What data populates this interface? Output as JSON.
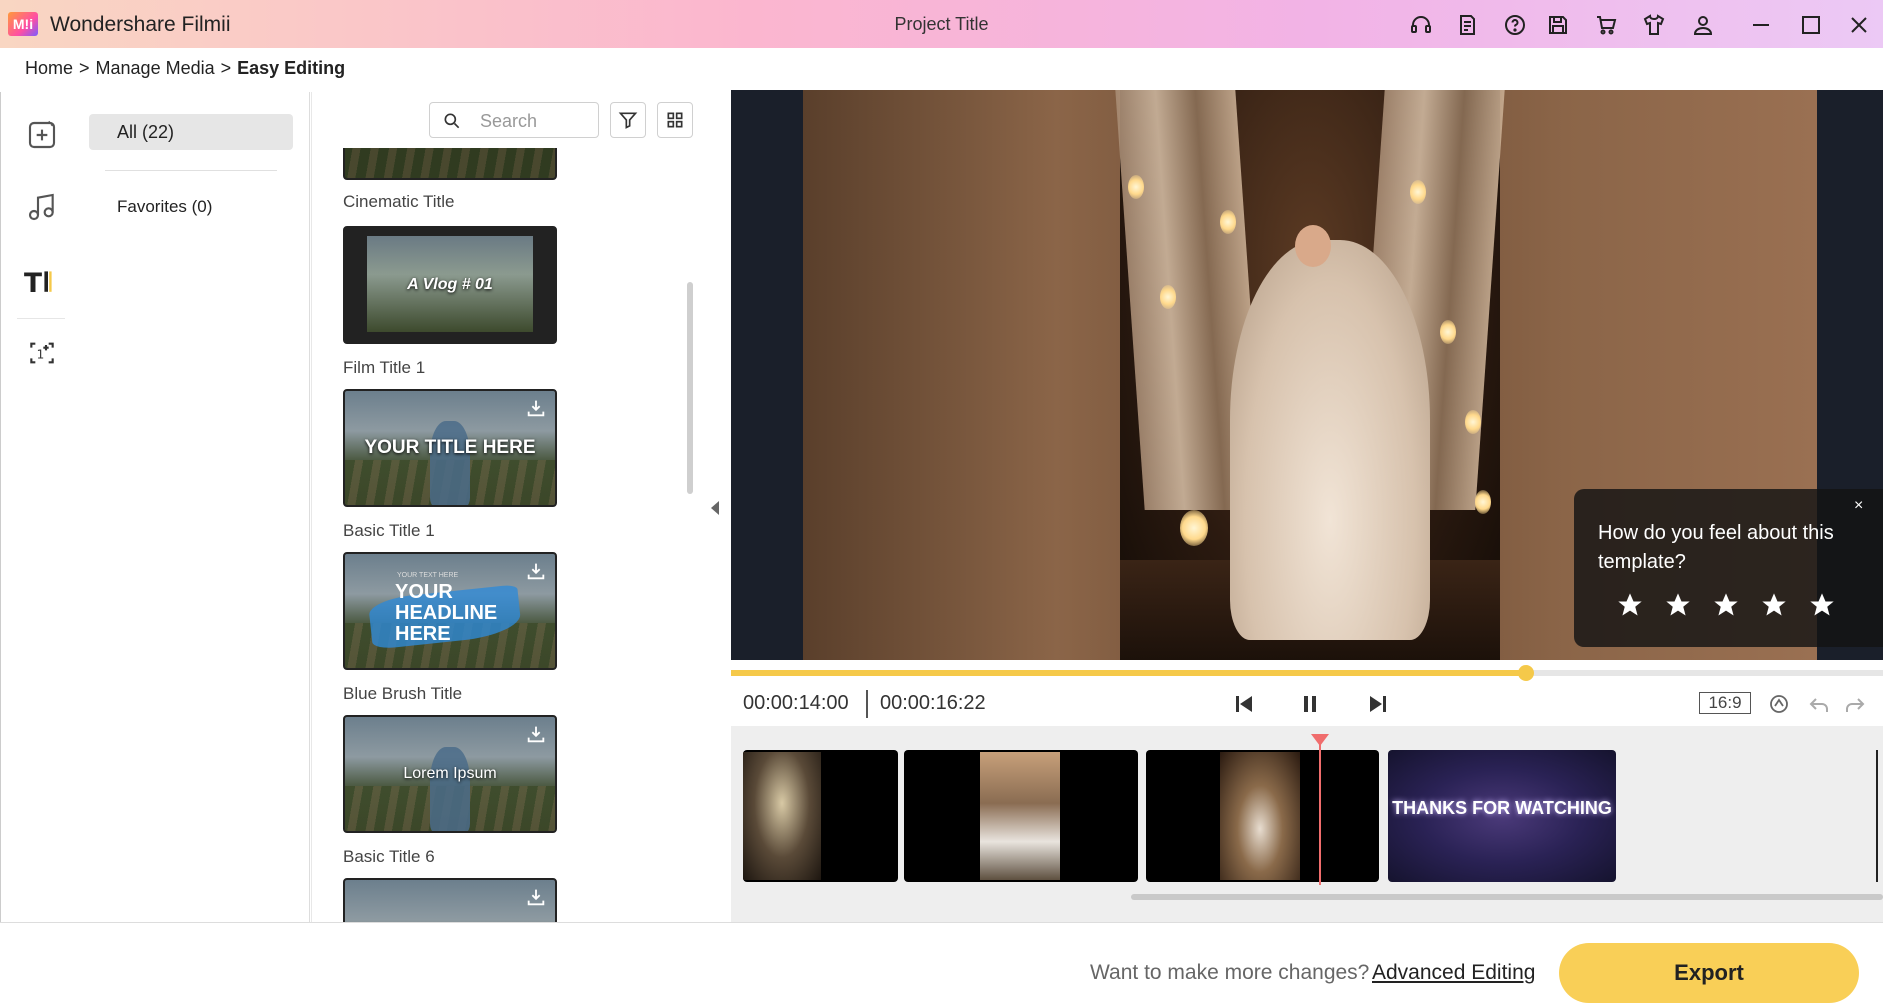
{
  "app": {
    "name": "Wondershare Filmii",
    "logo_text": "M!i",
    "project_title": "Project Title",
    "toolbar_icons": [
      "headset-icon",
      "notes-icon",
      "help-icon",
      "save-icon",
      "cart-icon",
      "shirt-icon",
      "user-icon"
    ],
    "window_controls": [
      "minimize-icon",
      "maximize-icon",
      "close-icon"
    ]
  },
  "breadcrumb": {
    "items": [
      "Home",
      ">",
      "Manage Media",
      ">",
      "Easy Editing"
    ]
  },
  "leftnav": [
    "add-media-icon",
    "music-icon",
    "title-text-icon",
    "counter-icon"
  ],
  "categories": {
    "all": "All (22)",
    "favorites": "Favorites (0)"
  },
  "search": {
    "placeholder": "Search"
  },
  "templates": [
    {
      "label": "Cinematic Title",
      "overlay": ""
    },
    {
      "label": "Film Title 1",
      "overlay": "A Vlog # 01"
    },
    {
      "label": "Basic Title 1",
      "overlay": "YOUR TITLE HERE"
    },
    {
      "label": "Blue Brush Title",
      "overlay": "YOUR HEADLINE HERE",
      "small": "YOUR TEXT HERE"
    },
    {
      "label": "Basic Title 6",
      "overlay": "Lorem Ipsum"
    },
    {
      "label": "",
      "overlay": ""
    }
  ],
  "rating": {
    "question": "How do you feel about this template?",
    "close": "×",
    "stars": 5
  },
  "player": {
    "progress": 0.69,
    "current_time": "00:00:14:00",
    "total_time": "00:00:16:22",
    "aspect": "16:9"
  },
  "timeline": {
    "clips": [
      "couple-night",
      "couple-sunset",
      "bride-bulbs",
      "thanks-for-watching"
    ],
    "end_card_text": "THANKS FOR WATCHING"
  },
  "footer": {
    "prompt": "Want to make more changes?",
    "advanced_link": "Advanced Editing",
    "export": "Export"
  },
  "colors": {
    "accent": "#f9cf57",
    "playhead": "#f06d6d"
  }
}
